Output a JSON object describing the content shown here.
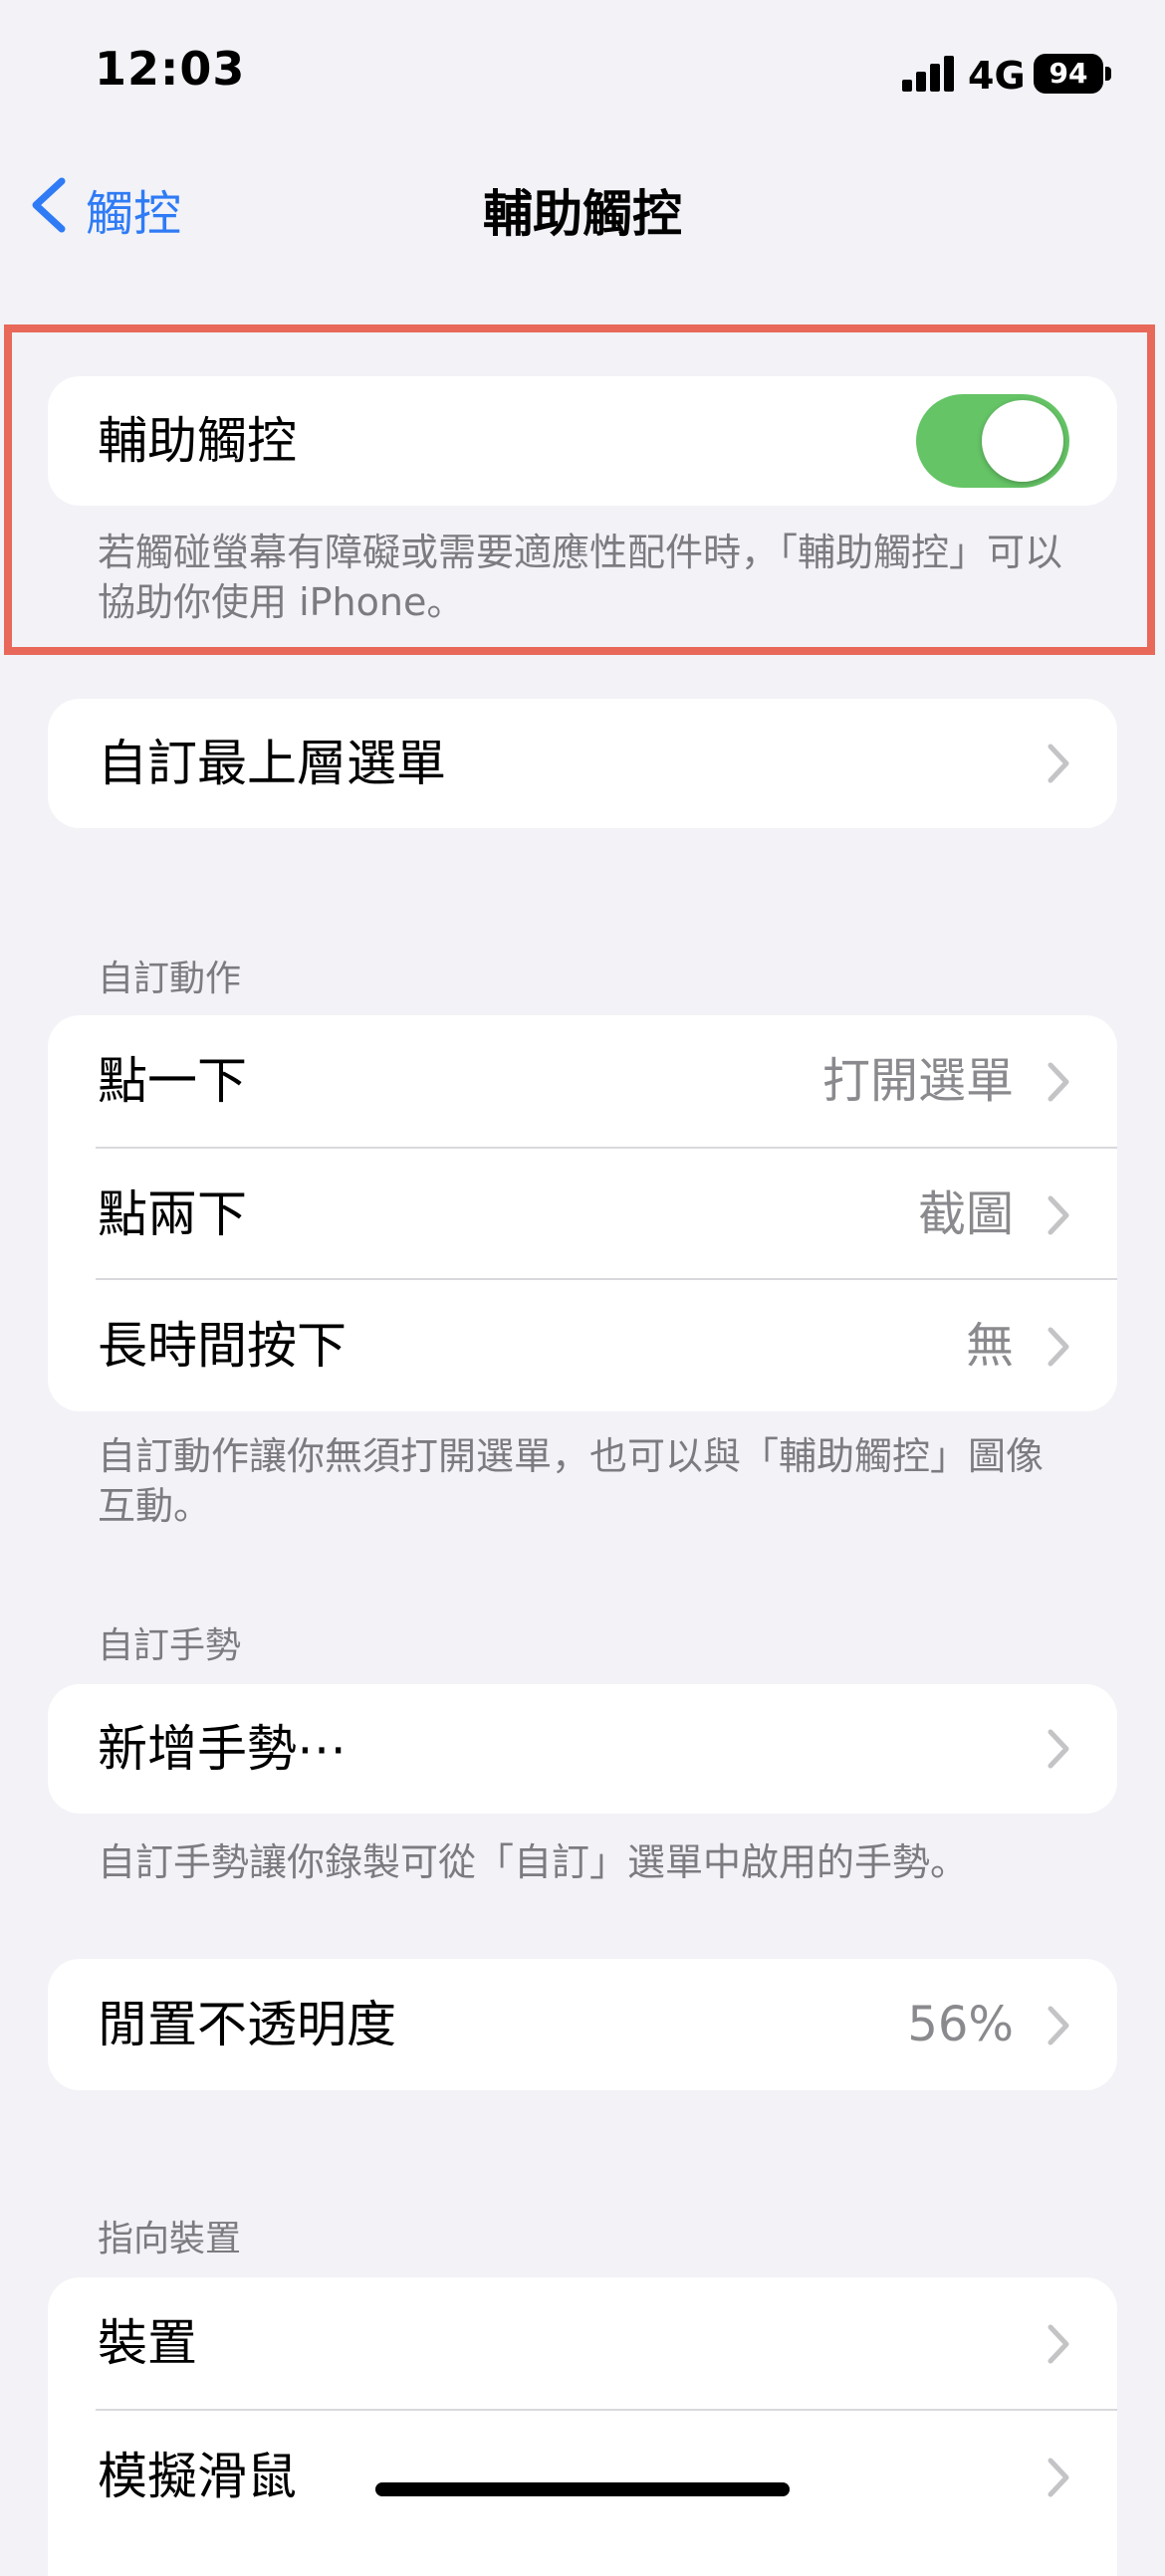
{
  "status_bar": {
    "time": "12:03",
    "network": "4G",
    "battery": "94"
  },
  "nav": {
    "back_label": "觸控",
    "title": "輔助觸控"
  },
  "main_toggle": {
    "label": "輔助觸控",
    "on": true,
    "accent_color": "#65c466",
    "footer": "若觸碰螢幕有障礙或需要適應性配件時，「輔助觸控」可以協助你使用 iPhone。"
  },
  "top_menu": {
    "label": "自訂最上層選單"
  },
  "custom_actions": {
    "header": "自訂動作",
    "rows": [
      {
        "label": "點一下",
        "value": "打開選單"
      },
      {
        "label": "點兩下",
        "value": "截圖"
      },
      {
        "label": "長時間按下",
        "value": "無"
      }
    ],
    "footer": "自訂動作讓你無須打開選單，也可以與「輔助觸控」圖像互動。"
  },
  "custom_gestures": {
    "header": "自訂手勢",
    "add_label": "新增手勢⋯",
    "footer": "自訂手勢讓你錄製可從「自訂」選單中啟用的手勢。"
  },
  "idle_opacity": {
    "label": "閒置不透明度",
    "value": "56%"
  },
  "pointer_devices": {
    "header": "指向裝置",
    "rows": [
      {
        "label": "裝置"
      },
      {
        "label": "模擬滑鼠"
      }
    ]
  },
  "colors": {
    "link_blue": "#2f7bf5",
    "highlight_border": "#e8685a"
  }
}
